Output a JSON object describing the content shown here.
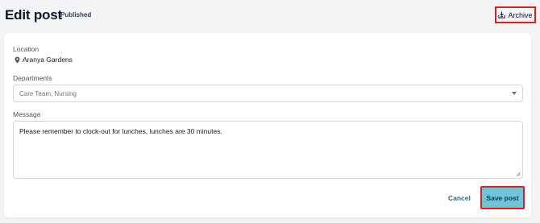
{
  "header": {
    "title": "Edit post",
    "status": "Published",
    "archive_label": "Archive",
    "archive_icon": "archive-download-icon"
  },
  "form": {
    "location": {
      "label": "Location",
      "value": "Aranya Gardens",
      "icon": "map-pin-icon"
    },
    "departments": {
      "label": "Departments",
      "selected": "Care Team, Nursing",
      "icon": "chevron-down-icon"
    },
    "message": {
      "label": "Message",
      "value": "Please remember to clock-out for lunches, lunches are 30 minutes."
    }
  },
  "actions": {
    "cancel_label": "Cancel",
    "save_label": "Save post"
  },
  "colors": {
    "background": "#f3f4f6",
    "card": "#ffffff",
    "primary_button": "#6fc4d7",
    "link": "#2c6a7d",
    "highlight_border": "#e11d1d"
  }
}
